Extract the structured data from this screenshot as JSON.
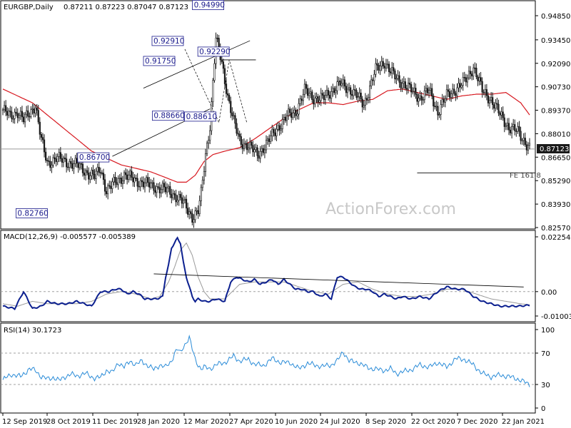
{
  "header": {
    "symbol": "EURGBP,Daily",
    "ohlc": "0.87211 0.87223 0.87047 0.87123"
  },
  "watermark": "ActionForex.com",
  "current_price_label": "0.87123",
  "fib_label": "FE 161.8",
  "colors": {
    "candles": "#1a1a1a",
    "ma": "#d71920",
    "macd": "#0b1f8f",
    "signal": "#9a9a9a",
    "rsi": "#2b8cd8",
    "annotation_border": "#1a1a8c",
    "current_price_bg": "#1a1a1a",
    "dashed_level": "#a0a0a0"
  },
  "chart_data": [
    {
      "type": "candlestick",
      "panel": "price",
      "title": "EURGBP,Daily",
      "y_ticks": [
        "0.94850",
        "0.93450",
        "0.92090",
        "0.90730",
        "0.89370",
        "0.88010",
        "0.86650",
        "0.85290",
        "0.83930",
        "0.82570"
      ],
      "ylim": [
        0.8257,
        0.9555
      ],
      "x_ticks": [
        "12 Sep 2019",
        "28 Oct 2019",
        "11 Dec 2019",
        "28 Jan 2020",
        "12 Mar 2020",
        "27 Apr 2020",
        "10 Jun 2020",
        "24 Jul 2020",
        "8 Sep 2020",
        "22 Oct 2020",
        "7 Dec 2020",
        "22 Jan 2021"
      ],
      "close_path_index": [
        0,
        5,
        10,
        14,
        18,
        22,
        26,
        30,
        36,
        42,
        50,
        58,
        62,
        66,
        70,
        76,
        82,
        90,
        100,
        108,
        114,
        122,
        128,
        132,
        134,
        137,
        140,
        144,
        148,
        152,
        156,
        160,
        166,
        172,
        178,
        186,
        192,
        198,
        204,
        210,
        216,
        222,
        228,
        236,
        244,
        252,
        258,
        262,
        266,
        270,
        276,
        282,
        288,
        294,
        300,
        306,
        312,
        318,
        324,
        330,
        336,
        342,
        348,
        356
      ],
      "close_path_price": [
        0.894,
        0.89,
        0.893,
        0.888,
        0.892,
        0.897,
        0.876,
        0.863,
        0.866,
        0.864,
        0.862,
        0.857,
        0.855,
        0.86,
        0.847,
        0.852,
        0.856,
        0.853,
        0.85,
        0.848,
        0.846,
        0.84,
        0.832,
        0.835,
        0.845,
        0.868,
        0.885,
        0.935,
        0.921,
        0.902,
        0.887,
        0.876,
        0.873,
        0.868,
        0.874,
        0.884,
        0.89,
        0.893,
        0.905,
        0.901,
        0.9,
        0.905,
        0.909,
        0.905,
        0.897,
        0.917,
        0.922,
        0.916,
        0.912,
        0.91,
        0.905,
        0.901,
        0.905,
        0.893,
        0.902,
        0.906,
        0.91,
        0.919,
        0.905,
        0.9,
        0.891,
        0.884,
        0.881,
        0.872
      ],
      "ma_path_index": [
        0,
        20,
        40,
        60,
        80,
        100,
        112,
        118,
        124,
        130,
        136,
        142,
        150,
        160,
        170,
        180,
        190,
        200,
        210,
        220,
        230,
        240,
        250,
        260,
        270,
        280,
        290,
        300,
        310,
        320,
        330,
        340,
        350,
        356
      ],
      "ma_path_price": [
        0.906,
        0.898,
        0.884,
        0.87,
        0.862,
        0.858,
        0.854,
        0.852,
        0.852,
        0.856,
        0.864,
        0.868,
        0.87,
        0.872,
        0.877,
        0.883,
        0.889,
        0.894,
        0.898,
        0.898,
        0.897,
        0.899,
        0.9,
        0.905,
        0.906,
        0.904,
        0.902,
        0.9,
        0.902,
        0.903,
        0.903,
        0.904,
        0.898,
        0.891
      ],
      "annotations": [
        "0.94990",
        "0.91750",
        "0.92910",
        "0.92290",
        "0.86700",
        "0.88660",
        "0.88610",
        "0.82760"
      ],
      "annotation_index": [
        131,
        96,
        123,
        153,
        66,
        129,
        145,
        33
      ],
      "annotation_price": [
        0.9499,
        0.9175,
        0.9291,
        0.9229,
        0.867,
        0.8866,
        0.8861,
        0.8276
      ],
      "fib_level": 0.8574,
      "last_price": 0.87123
    },
    {
      "type": "line",
      "panel": "macd",
      "title": "MACD(12,26,9) -0.005577 -0.005389",
      "y_ticks": [
        "0.022544",
        "0.00",
        "-0.010039"
      ],
      "ylim": [
        -0.0125,
        0.0245
      ],
      "macd_path_index": [
        0,
        8,
        14,
        20,
        26,
        30,
        36,
        44,
        50,
        60,
        66,
        72,
        76,
        80,
        84,
        88,
        92,
        96,
        100,
        104,
        108,
        110,
        112,
        114,
        118,
        120,
        122,
        124,
        128,
        130,
        132,
        136,
        140,
        144,
        150,
        154,
        158,
        162,
        166,
        170,
        174,
        178,
        182,
        186,
        190,
        194,
        198,
        202,
        206,
        210,
        214,
        218,
        222,
        226,
        230,
        234,
        238,
        242,
        246,
        250,
        254,
        258,
        262,
        266,
        270,
        276,
        282,
        288,
        294,
        300,
        306,
        312,
        318,
        324,
        330,
        336,
        342,
        348,
        356
      ],
      "macd_path_value": [
        -0.006,
        -0.007,
        0.0,
        -0.007,
        -0.006,
        -0.004,
        -0.005,
        -0.005,
        -0.004,
        -0.006,
        0.0,
        0.0,
        0.001,
        0.001,
        -0.001,
        0.0,
        -0.001,
        -0.003,
        -0.003,
        -0.003,
        -0.002,
        0.006,
        0.011,
        0.018,
        0.022,
        0.02,
        0.012,
        0.006,
        -0.002,
        -0.004,
        -0.003,
        -0.004,
        -0.004,
        -0.003,
        -0.004,
        0.004,
        0.006,
        0.005,
        0.004,
        0.005,
        0.003,
        0.004,
        0.005,
        0.003,
        0.005,
        0.003,
        0.001,
        0.001,
        0.0,
        0.0,
        -0.002,
        -0.001,
        -0.003,
        0.006,
        0.006,
        0.004,
        0.002,
        0.001,
        0.001,
        0.0,
        -0.002,
        -0.001,
        -0.002,
        -0.003,
        -0.002,
        -0.003,
        -0.002,
        -0.003,
        0.0,
        0.002,
        0.001,
        0.001,
        -0.002,
        -0.004,
        -0.005,
        -0.006,
        -0.006,
        -0.006,
        -0.0056
      ],
      "signal_path_index": [
        0,
        10,
        20,
        30,
        40,
        50,
        60,
        70,
        80,
        90,
        100,
        106,
        112,
        116,
        120,
        124,
        128,
        132,
        136,
        140,
        150,
        160,
        170,
        180,
        190,
        200,
        210,
        220,
        230,
        240,
        250,
        260,
        270,
        280,
        290,
        300,
        310,
        320,
        330,
        340,
        350,
        356
      ],
      "signal_path_value": [
        -0.005,
        -0.006,
        -0.004,
        -0.005,
        -0.005,
        -0.005,
        -0.004,
        -0.001,
        0.0,
        -0.001,
        -0.003,
        -0.002,
        0.004,
        0.01,
        0.017,
        0.02,
        0.015,
        0.006,
        0.0,
        -0.003,
        -0.003,
        0.003,
        0.004,
        0.004,
        0.004,
        0.002,
        0.0,
        -0.001,
        0.003,
        0.004,
        0.001,
        -0.001,
        -0.002,
        -0.002,
        -0.001,
        0.001,
        0.001,
        -0.001,
        -0.003,
        -0.004,
        -0.005,
        -0.0054
      ],
      "trendline": [
        0.0073,
        0.0019
      ]
    },
    {
      "type": "line",
      "panel": "rsi",
      "title": "RSI(14) 30.1723",
      "y_ticks": [
        "100",
        "70",
        "30",
        "0"
      ],
      "ylim": [
        0,
        100
      ],
      "levels": [
        70,
        30
      ],
      "rsi_path_index": [
        0,
        6,
        12,
        18,
        22,
        26,
        30,
        34,
        38,
        42,
        46,
        50,
        56,
        62,
        66,
        70,
        74,
        78,
        82,
        86,
        90,
        94,
        98,
        102,
        106,
        110,
        114,
        116,
        118,
        120,
        122,
        124,
        126,
        128,
        130,
        132,
        134,
        136,
        140,
        144,
        150,
        156,
        160,
        166,
        170,
        176,
        182,
        188,
        194,
        200,
        206,
        210,
        216,
        222,
        226,
        230,
        234,
        240,
        246,
        250,
        254,
        258,
        262,
        266,
        270,
        276,
        282,
        288,
        294,
        300,
        306,
        312,
        318,
        324,
        330,
        336,
        342,
        348,
        356
      ],
      "rsi_path_value": [
        36,
        43,
        40,
        50,
        48,
        40,
        37,
        39,
        35,
        40,
        43,
        41,
        44,
        38,
        39,
        48,
        45,
        58,
        52,
        60,
        55,
        60,
        54,
        49,
        55,
        52,
        60,
        70,
        75,
        70,
        78,
        84,
        90,
        75,
        62,
        55,
        50,
        52,
        50,
        55,
        58,
        66,
        60,
        62,
        56,
        54,
        63,
        58,
        58,
        50,
        57,
        55,
        53,
        55,
        60,
        72,
        60,
        58,
        52,
        50,
        49,
        48,
        50,
        44,
        46,
        49,
        55,
        52,
        58,
        52,
        63,
        62,
        55,
        44,
        40,
        42,
        40,
        37,
        30
      ]
    }
  ]
}
